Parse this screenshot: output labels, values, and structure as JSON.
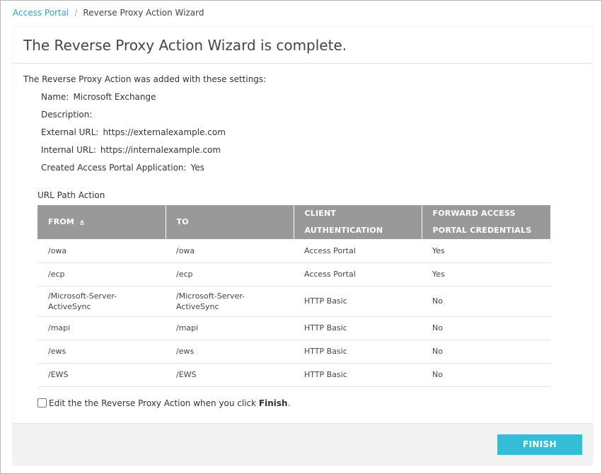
{
  "breadcrumb": {
    "parent": "Access Portal",
    "separator": "/",
    "current": "Reverse Proxy Action Wizard"
  },
  "title": "The Reverse Proxy Action Wizard is complete.",
  "intro": "The Reverse Proxy Action was added with these settings:",
  "settings": [
    {
      "label": "Name:",
      "value": "Microsoft Exchange"
    },
    {
      "label": "Description:",
      "value": ""
    },
    {
      "label": "External URL:",
      "value": "https://externalexample.com"
    },
    {
      "label": "Internal URL:",
      "value": "https://internalexample.com"
    },
    {
      "label": "Created Access Portal Application:",
      "value": "Yes"
    }
  ],
  "url_path_label": "URL Path Action",
  "table": {
    "headers": [
      "FROM",
      "TO",
      "CLIENT AUTHENTICATION",
      "FORWARD ACCESS PORTAL CREDENTIALS"
    ],
    "sort_icon": "sort-up-icon",
    "rows": [
      [
        "/owa",
        "/owa",
        "Access Portal",
        "Yes"
      ],
      [
        "/ecp",
        "/ecp",
        "Access Portal",
        "Yes"
      ],
      [
        "/Microsoft-Server-ActiveSync",
        "/Microsoft-Server-ActiveSync",
        "HTTP Basic",
        "No"
      ],
      [
        "/mapi",
        "/mapi",
        "HTTP Basic",
        "No"
      ],
      [
        "/ews",
        "/ews",
        "HTTP Basic",
        "No"
      ],
      [
        "/EWS",
        "/EWS",
        "HTTP Basic",
        "No"
      ]
    ]
  },
  "edit_option": {
    "text_before": "Edit the the Reverse Proxy Action when you click ",
    "text_bold": "Finish",
    "text_after": ".",
    "checked": false
  },
  "finish_label": "FINISH",
  "colors": {
    "link": "#2ba6cb",
    "header_bg": "#999999",
    "button": "#35bcd6",
    "footer_bg": "#f2f2f2"
  }
}
